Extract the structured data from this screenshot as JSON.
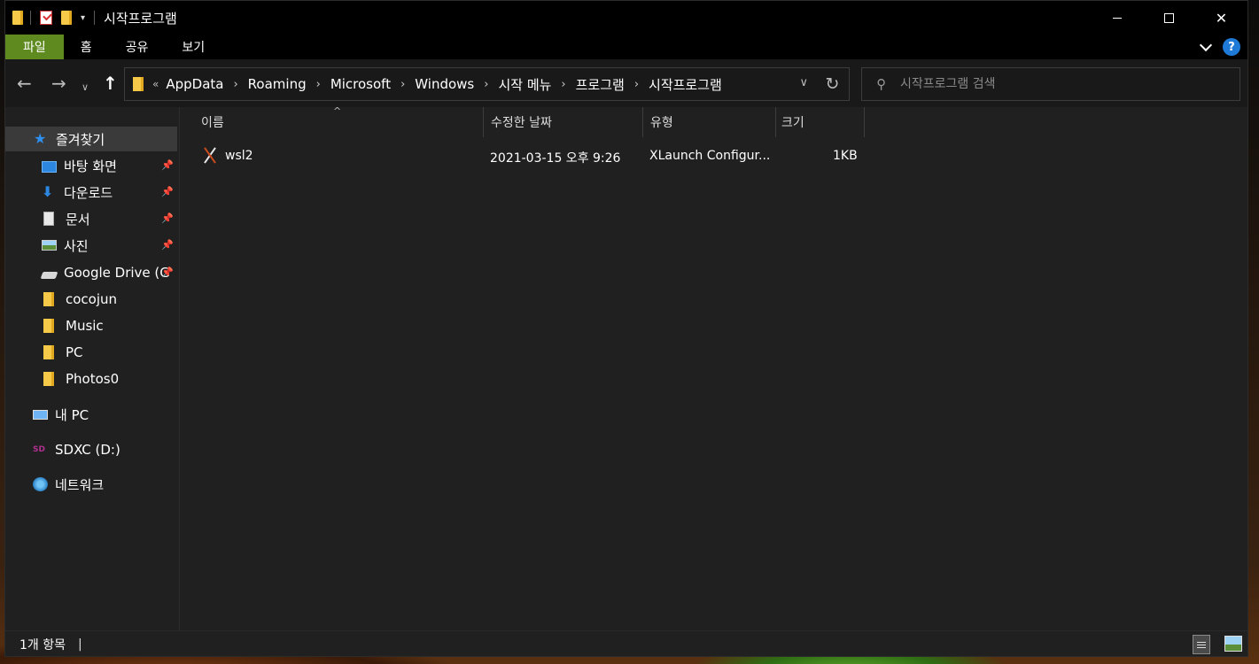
{
  "window": {
    "title": "시작프로그램",
    "controls": {
      "minimize": "minimize",
      "maximize": "maximize",
      "close": "✕"
    }
  },
  "ribbon": {
    "tabs": [
      "파일",
      "홈",
      "공유",
      "보기"
    ],
    "help": "?"
  },
  "navigation": {
    "breadcrumb_overflow": "«",
    "breadcrumbs": [
      "AppData",
      "Roaming",
      "Microsoft",
      "Windows",
      "시작 메뉴",
      "프로그램",
      "시작프로그램"
    ],
    "search_placeholder": "시작프로그램 검색"
  },
  "sidebar": {
    "items": [
      {
        "label": "즐겨찾기",
        "icon": "star-icon",
        "selected": true
      },
      {
        "label": "바탕 화면",
        "icon": "desktop-icon",
        "pinned": true
      },
      {
        "label": "다운로드",
        "icon": "download-icon",
        "pinned": true
      },
      {
        "label": "문서",
        "icon": "document-icon",
        "pinned": true
      },
      {
        "label": "사진",
        "icon": "pictures-icon",
        "pinned": true
      },
      {
        "label": "Google Drive (G",
        "icon": "drive-icon",
        "pinned": true
      },
      {
        "label": "cocojun",
        "icon": "folder-icon"
      },
      {
        "label": "Music",
        "icon": "folder-icon"
      },
      {
        "label": "PC",
        "icon": "folder-icon"
      },
      {
        "label": "Photos0",
        "icon": "folder-icon"
      },
      {
        "label": "내 PC",
        "icon": "computer-icon"
      },
      {
        "label": "SDXC (D:)",
        "icon": "sd-card-icon"
      },
      {
        "label": "네트워크",
        "icon": "network-icon"
      }
    ]
  },
  "file_list": {
    "columns": [
      "이름",
      "수정한 날짜",
      "유형",
      "크기"
    ],
    "rows": [
      {
        "name": "wsl2",
        "modified": "2021-03-15 오후 9:26",
        "type": "XLaunch Configur...",
        "size": "1KB",
        "icon": "xlaunch-icon"
      }
    ]
  },
  "status": {
    "item_count": "1개 항목",
    "separator": "|"
  }
}
